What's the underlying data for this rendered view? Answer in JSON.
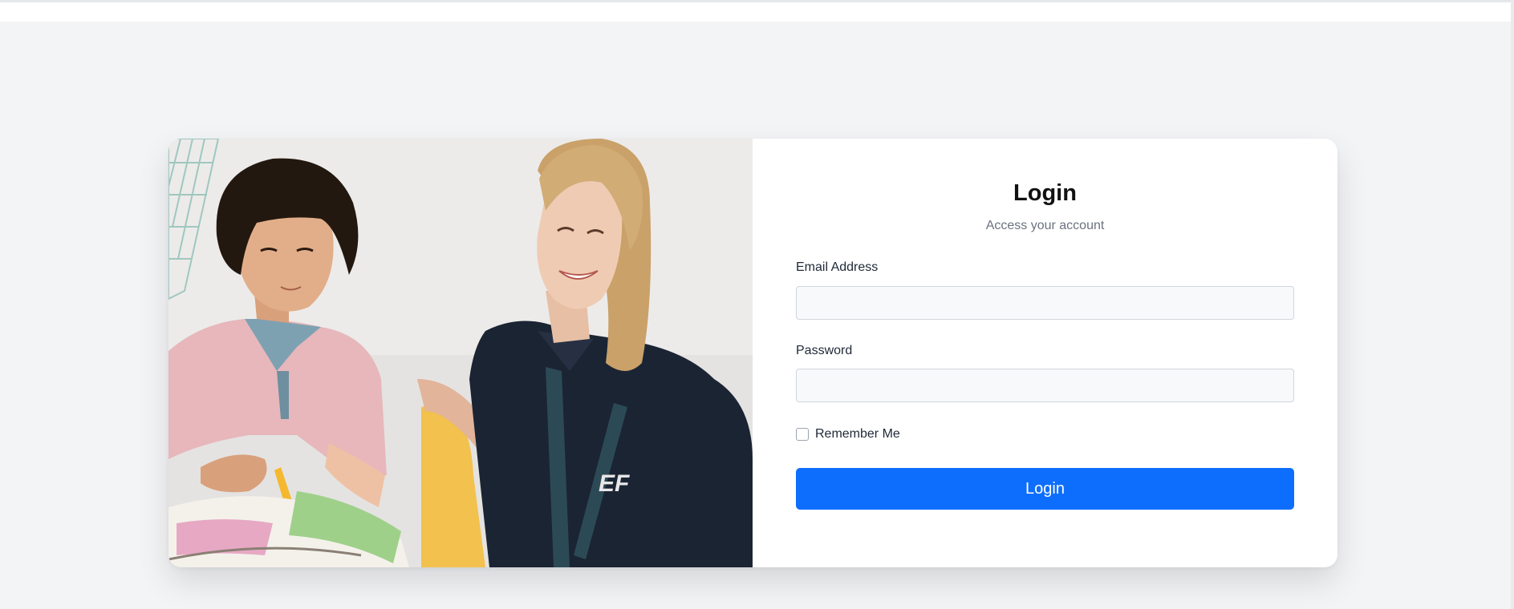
{
  "login": {
    "title": "Login",
    "subtitle": "Access your account",
    "email_label": "Email Address",
    "email_value": "",
    "password_label": "Password",
    "password_value": "",
    "remember_label": "Remember Me",
    "remember_checked": false,
    "submit_label": "Login"
  },
  "hero": {
    "image_desc": "photo-child-reading-with-teacher",
    "logo_mark": "EF"
  },
  "colors": {
    "page_bg": "#f3f4f6",
    "card_bg": "#ffffff",
    "primary": "#0d6efd",
    "muted_text": "#6b7280"
  }
}
